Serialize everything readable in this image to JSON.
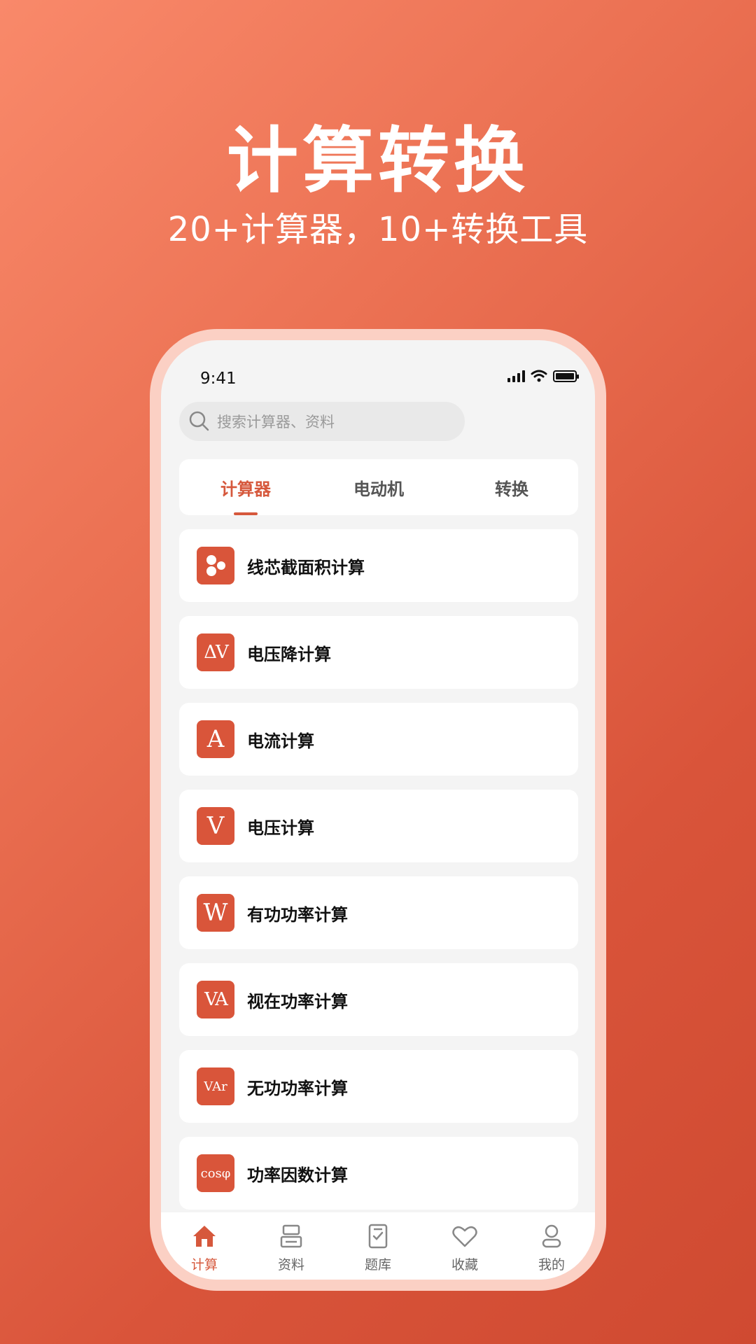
{
  "hero": {
    "title": "计算转换",
    "subtitle": "20+计算器，10+转换工具"
  },
  "status_bar": {
    "time": "9:41"
  },
  "search": {
    "placeholder": "搜索计算器、资料"
  },
  "tabs": [
    {
      "label": "计算器",
      "active": true
    },
    {
      "label": "电动机",
      "active": false
    },
    {
      "label": "转换",
      "active": false
    }
  ],
  "items": [
    {
      "icon_text": "",
      "icon": "wire-cores-icon",
      "label": "线芯截面积计算"
    },
    {
      "icon_text": "ΔV",
      "icon": "voltage-drop-icon",
      "label": "电压降计算"
    },
    {
      "icon_text": "A",
      "icon": "current-icon",
      "label": "电流计算"
    },
    {
      "icon_text": "V",
      "icon": "voltage-icon",
      "label": "电压计算"
    },
    {
      "icon_text": "W",
      "icon": "active-power-icon",
      "label": "有功功率计算"
    },
    {
      "icon_text": "VA",
      "icon": "apparent-power-icon",
      "label": "视在功率计算"
    },
    {
      "icon_text": "VAr",
      "icon": "reactive-power-icon",
      "label": "无功功率计算"
    },
    {
      "icon_text": "cosφ",
      "icon": "power-factor-icon",
      "label": "功率因数计算"
    }
  ],
  "nav": [
    {
      "label": "计算",
      "icon": "home-icon",
      "active": true
    },
    {
      "label": "资料",
      "icon": "stack-icon",
      "active": false
    },
    {
      "label": "题库",
      "icon": "checklist-icon",
      "active": false
    },
    {
      "label": "收藏",
      "icon": "heart-icon",
      "active": false
    },
    {
      "label": "我的",
      "icon": "profile-icon",
      "active": false
    }
  ],
  "colors": {
    "accent": "#d6583c",
    "icon_bg": "#d9553a",
    "frame": "#fbd0c4"
  }
}
